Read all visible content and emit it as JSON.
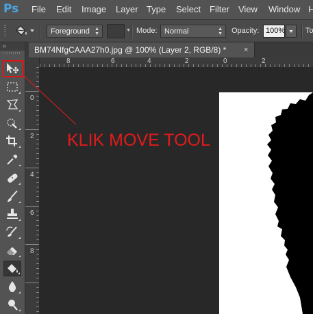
{
  "app": {
    "logo_text": "Ps",
    "menu": [
      "File",
      "Edit",
      "Image",
      "Layer",
      "Type",
      "Select",
      "Filter",
      "View",
      "Window",
      "H"
    ]
  },
  "options_bar": {
    "tool_icon": "paint-bucket-icon",
    "fill_source": "Foreground",
    "mode_label": "Mode:",
    "mode_value": "Normal",
    "opacity_label": "Opacity:",
    "opacity_value": "100%",
    "tolerance_label": "Tol"
  },
  "document": {
    "tab_title": "BM74NfgCAAA27h0.jpg @ 100% (Layer 2, RGB/8) *",
    "close_glyph": "×"
  },
  "rulers": {
    "top_labels": [
      "8",
      "6",
      "4",
      "2",
      "0",
      "2"
    ],
    "left_labels": [
      "0",
      "2",
      "4",
      "6",
      "8"
    ]
  },
  "toolbox": {
    "collapse_glyph": "»",
    "tools": [
      {
        "name": "move-tool",
        "icon": "move-icon",
        "active": false
      },
      {
        "name": "marquee-tool",
        "icon": "rectangular-marquee-icon",
        "active": false
      },
      {
        "name": "lasso-tool",
        "icon": "polygonal-lasso-icon",
        "active": false
      },
      {
        "name": "quick-selection-tool",
        "icon": "quick-selection-icon",
        "active": false
      },
      {
        "name": "crop-tool",
        "icon": "crop-icon",
        "active": false
      },
      {
        "name": "eyedropper-tool",
        "icon": "eyedropper-icon",
        "active": false
      },
      {
        "name": "healing-brush-tool",
        "icon": "bandage-icon",
        "active": false
      },
      {
        "name": "brush-tool",
        "icon": "brush-icon",
        "active": false
      },
      {
        "name": "clone-stamp-tool",
        "icon": "stamp-icon",
        "active": false
      },
      {
        "name": "history-brush-tool",
        "icon": "history-brush-icon",
        "active": false
      },
      {
        "name": "eraser-tool",
        "icon": "eraser-icon",
        "active": false
      },
      {
        "name": "paint-bucket-tool",
        "icon": "paint-bucket-icon",
        "active": true
      },
      {
        "name": "blur-tool",
        "icon": "drop-icon",
        "active": false
      },
      {
        "name": "dodge-tool",
        "icon": "dodge-icon",
        "active": false
      }
    ]
  },
  "annotation": {
    "text": "KLIK MOVE TOOL",
    "color": "#e21b1b"
  },
  "colors": {
    "menu_bg": "#535353",
    "workspace_bg": "#282828",
    "logo": "#4aa3e0",
    "canvas": "#ffffff"
  }
}
